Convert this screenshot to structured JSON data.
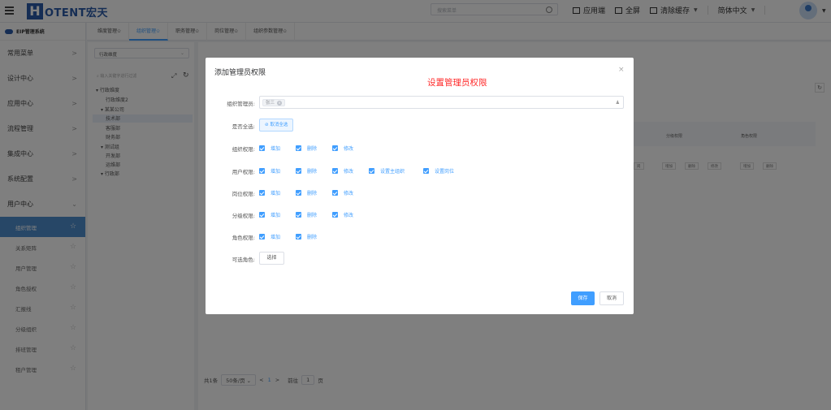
{
  "app": {
    "logo_mark": "H",
    "logo_text": "OTENT宏天"
  },
  "header": {
    "search_placeholder": "搜索菜单",
    "actions": [
      {
        "label": "应用端",
        "icon": "monitor-icon"
      },
      {
        "label": "全屏",
        "icon": "fullscreen-icon"
      },
      {
        "label": "清除缓存",
        "icon": "broom-icon"
      },
      {
        "label": "简体中文",
        "icon": "language-icon"
      }
    ]
  },
  "sidebar": {
    "title": "EIP管理系统",
    "groups": [
      {
        "label": "常用菜单"
      },
      {
        "label": "设计中心"
      },
      {
        "label": "应用中心"
      },
      {
        "label": "流程管理"
      },
      {
        "label": "集成中心"
      },
      {
        "label": "系统配置"
      }
    ],
    "open_group": "用户中心",
    "items": [
      {
        "label": "组织管理",
        "active": true
      },
      {
        "label": "关系矩阵"
      },
      {
        "label": "用户管理"
      },
      {
        "label": "角色授权"
      },
      {
        "label": "汇报线"
      },
      {
        "label": "分级组织"
      },
      {
        "label": "排班管理"
      },
      {
        "label": "租户管理"
      }
    ]
  },
  "tabs": [
    {
      "label": "维度管理✩"
    },
    {
      "label": "组织管理✩",
      "active": true
    },
    {
      "label": "职务管理✩"
    },
    {
      "label": "岗位管理✩"
    },
    {
      "label": "组织参数管理✩"
    }
  ],
  "tree": {
    "dimension": "行政维度",
    "search_placeholder": "输入关键字进行过滤",
    "nodes": [
      {
        "label": "▾ 行政维度"
      },
      {
        "label": "行政维度2"
      },
      {
        "label": "▾ 某某公司"
      },
      {
        "label": "技术部",
        "selected": true
      },
      {
        "label": "客服部"
      },
      {
        "label": "财务部"
      },
      {
        "label": "▾ 测试组"
      },
      {
        "label": "开发部"
      },
      {
        "label": "运维部"
      },
      {
        "label": "▾ 行政部"
      }
    ]
  },
  "table": {
    "col_headers": [
      "分级权限",
      "角色权限"
    ],
    "row_buttons_a": [
      "增加",
      "删除",
      "修改"
    ],
    "row_buttons_b": [
      "增加",
      "删除"
    ],
    "partial_button": "岗"
  },
  "pager": {
    "total": "共1条",
    "page_size": "50条/页",
    "prev": "<",
    "current": "1",
    "next": ">",
    "goto_label": "前往",
    "goto_value": "1",
    "page_unit": "页"
  },
  "modal": {
    "title": "添加管理员权限",
    "annotation": "设置管理员权限",
    "admin_label": "组织管理员:",
    "admin_tag": "张三",
    "select_all_label": "是否全选:",
    "select_all_button": "⊘ 取消全选",
    "permissions": [
      {
        "label": "组织权限:",
        "options": [
          "增加",
          "删除",
          "修改"
        ]
      },
      {
        "label": "用户权限:",
        "options": [
          "增加",
          "删除",
          "修改",
          "设置主组织",
          "设置岗位"
        ]
      },
      {
        "label": "岗位权限:",
        "options": [
          "增加",
          "删除",
          "修改"
        ]
      },
      {
        "label": "分级权限:",
        "options": [
          "增加",
          "删除",
          "修改"
        ]
      },
      {
        "label": "角色权限:",
        "options": [
          "增加",
          "删除"
        ]
      }
    ],
    "roles_label": "可选角色:",
    "choose_button": "选择",
    "save_button": "保存",
    "cancel_button": "取消",
    "close_glyph": "×"
  }
}
